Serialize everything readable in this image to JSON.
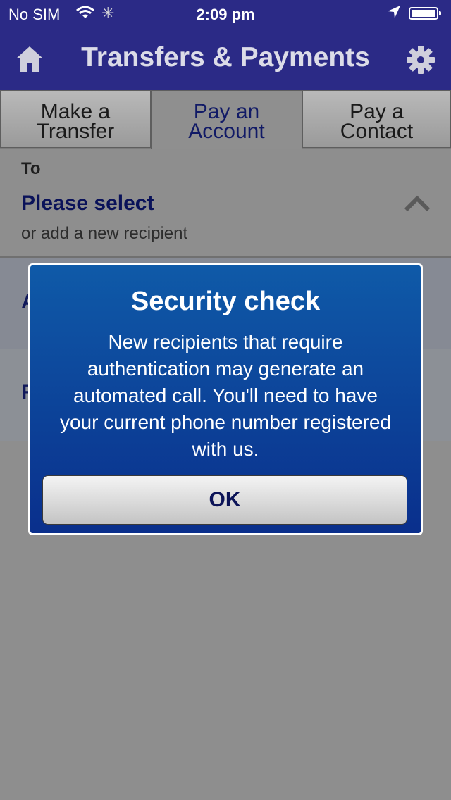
{
  "status_bar": {
    "carrier": "No SIM",
    "time": "2:09 pm"
  },
  "nav": {
    "title": "Transfers & Payments",
    "home_icon": "home-icon",
    "settings_icon": "gear-icon"
  },
  "tabs": [
    {
      "line1": "Make a",
      "line2": "Transfer"
    },
    {
      "line1": "Pay an",
      "line2": "Account",
      "active": true
    },
    {
      "line1": "Pay a",
      "line2": "Contact"
    }
  ],
  "form": {
    "to_label": "To",
    "recipient_value": "Please select",
    "recipient_hint": "or add a new recipient",
    "row2_letter": "A",
    "row3_letter": "F"
  },
  "dialog": {
    "title": "Security check",
    "message": "New recipients that require authentication may generate an automated call. You'll need to have your current phone number registered with us.",
    "ok_label": "OK"
  },
  "colors": {
    "nav_bg": "#2b2a86",
    "dialog_top": "#0f5aa8",
    "dialog_bottom": "#0a2f8c",
    "overlay": "#8e8e8e"
  }
}
